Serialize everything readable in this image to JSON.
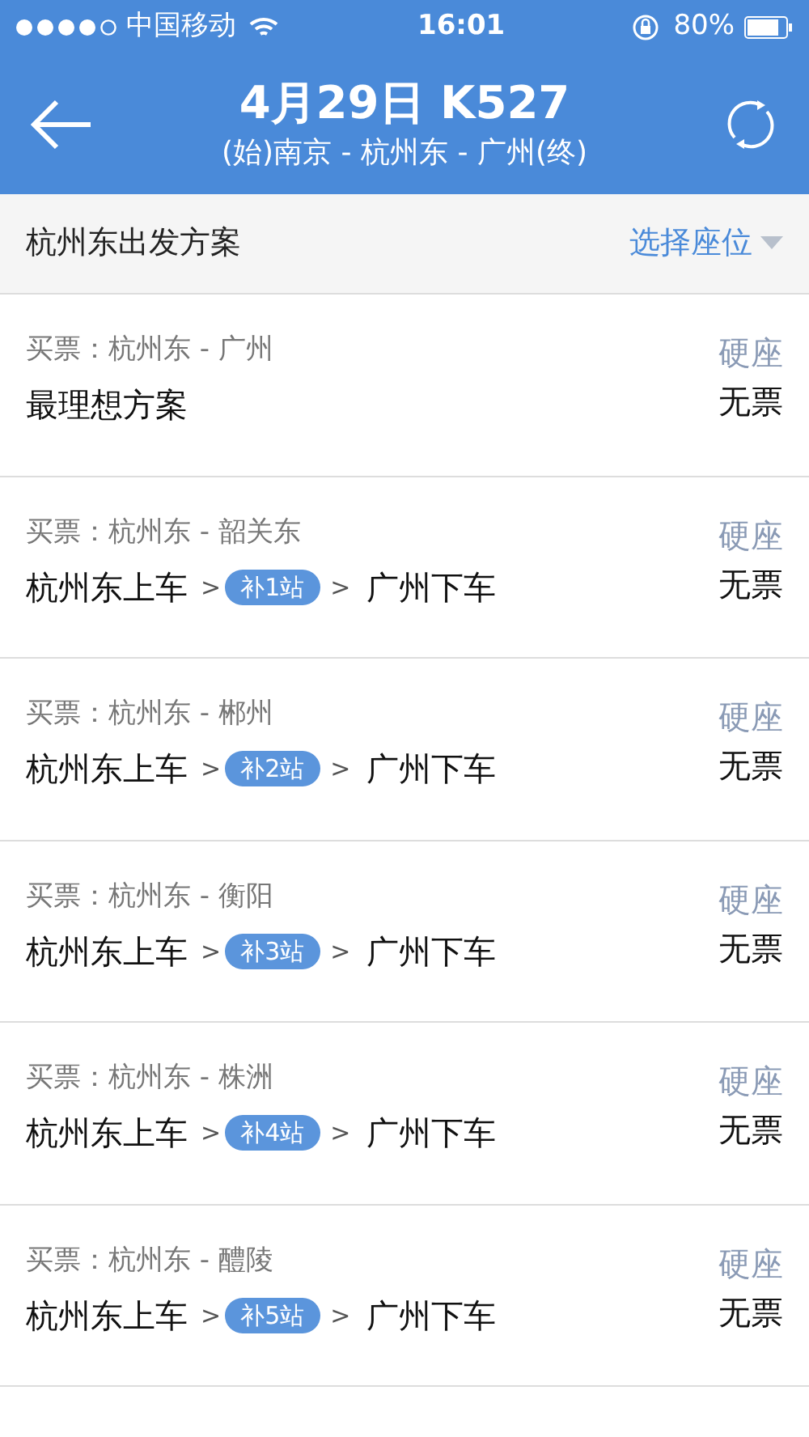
{
  "status_bar": {
    "carrier": "中国移动",
    "time": "16:01",
    "battery_text": "80%"
  },
  "header": {
    "title": "4月29日 K527",
    "subtitle": "(始)南京 - 杭州东 - 广州(终)"
  },
  "subheader": {
    "title": "杭州东出发方案",
    "seat_selector": "选择座位"
  },
  "plans": [
    {
      "kind": "direct",
      "ticket": "买票：杭州东 - 广州",
      "plan": "最理想方案",
      "seat": "硬座",
      "availability": "无票"
    },
    {
      "kind": "transfer",
      "ticket": "买票：杭州东 - 韶关东",
      "board": "杭州东上车",
      "sep1": ">",
      "badge": "补1站",
      "sep2": ">",
      "alight": "广州下车",
      "seat": "硬座",
      "availability": "无票"
    },
    {
      "kind": "transfer",
      "ticket": "买票：杭州东 - 郴州",
      "board": "杭州东上车",
      "sep1": ">",
      "badge": "补2站",
      "sep2": ">",
      "alight": "广州下车",
      "seat": "硬座",
      "availability": "无票"
    },
    {
      "kind": "transfer",
      "ticket": "买票：杭州东 - 衡阳",
      "board": "杭州东上车",
      "sep1": ">",
      "badge": "补3站",
      "sep2": ">",
      "alight": "广州下车",
      "seat": "硬座",
      "availability": "无票"
    },
    {
      "kind": "transfer",
      "ticket": "买票：杭州东 - 株洲",
      "board": "杭州东上车",
      "sep1": ">",
      "badge": "补4站",
      "sep2": ">",
      "alight": "广州下车",
      "seat": "硬座",
      "availability": "无票"
    },
    {
      "kind": "transfer",
      "ticket": "买票：杭州东 - 醴陵",
      "board": "杭州东上车",
      "sep1": ">",
      "badge": "补5站",
      "sep2": ">",
      "alight": "广州下车",
      "seat": "硬座",
      "availability": "无票"
    }
  ]
}
